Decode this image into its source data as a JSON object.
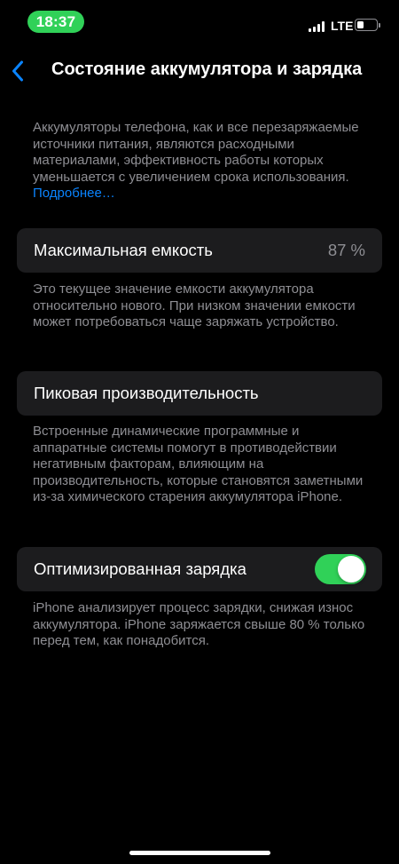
{
  "status_bar": {
    "time": "18:37",
    "network": "LTE"
  },
  "nav": {
    "back_icon": "chevron-left-icon",
    "title": "Состояние аккумулятора и зарядка"
  },
  "intro": {
    "text": "Аккумуляторы телефона, как и все перезаряжаемые источники питания, являются расходными материалами, эффективность работы которых уменьшается с увеличением срока использования.",
    "link": "Подробнее…"
  },
  "max_capacity": {
    "label": "Максимальная емкость",
    "value": "87 %",
    "footnote": "Это текущее значение емкости аккумулятора относительно нового. При низком значении емкости может потребоваться чаще заряжать устройство."
  },
  "peak_performance": {
    "label": "Пиковая производительность",
    "footnote": "Встроенные динамические программные и аппаратные системы помогут в противодействии негативным факторам, влияющим на производительность, которые становятся заметными из-за химического старения аккумулятора iPhone."
  },
  "optimized_charging": {
    "label": "Оптимизированная зарядка",
    "enabled": true,
    "footnote": "iPhone анализирует процесс зарядки, снижая износ аккумулятора. iPhone заряжается свыше 80 % только перед тем, как понадобится."
  },
  "colors": {
    "background": "#000000",
    "card": "#1c1c1e",
    "accent": "#0a84ff",
    "toggle_on": "#30d158",
    "secondary_text": "#8e8e93"
  }
}
